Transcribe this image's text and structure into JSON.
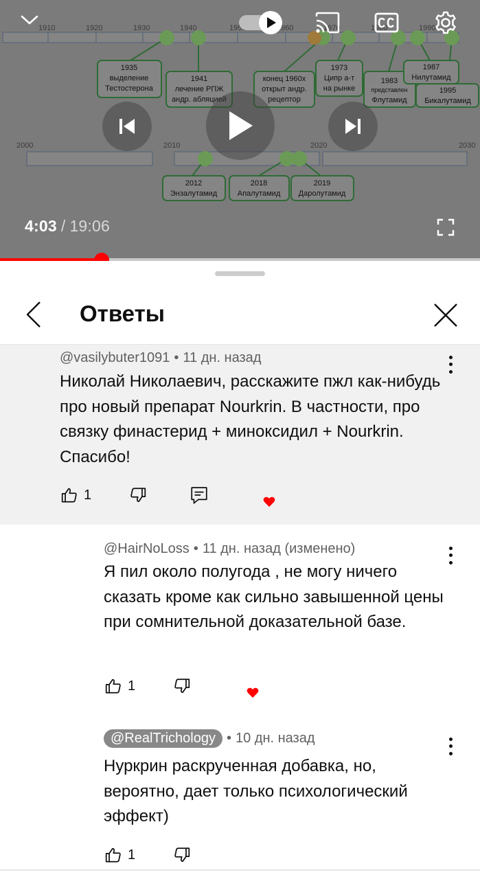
{
  "player": {
    "current_time": "4:03",
    "separator": "/",
    "duration": "19:06",
    "progress": 0.212,
    "icons": {
      "collapse": "chevron-down-icon",
      "autoplay": "autoplay-toggle-icon",
      "cast": "cast-icon",
      "captions": "captions-icon",
      "settings": "gear-icon",
      "previous": "skip-previous-icon",
      "play": "play-icon",
      "next": "skip-next-icon",
      "fullscreen": "fullscreen-icon"
    },
    "slide": {
      "timeline1_ticks": [
        "1910",
        "1920",
        "1930",
        "1940",
        "1950",
        "1960",
        "1970",
        "1980",
        "1990"
      ],
      "timeline2_ticks": [
        "2000",
        "2010",
        "2020",
        "2030"
      ],
      "events": [
        {
          "year": "1935",
          "text1": "выделение",
          "text2": "Тестостерона"
        },
        {
          "year": "1941",
          "text1": "лечение РПЖ",
          "text2": "андр. абляцией"
        },
        {
          "year": "конец 1960х",
          "text1": "открыт андр.",
          "text2": "рецептор"
        },
        {
          "year": "1973",
          "text1": "Ципр а-т",
          "text2": "на рынке"
        },
        {
          "year": "1983",
          "text1": "представлен",
          "text2": "Флутамид"
        },
        {
          "year": "1987",
          "text1": "Нилутамид",
          "text2": ""
        },
        {
          "year": "1995",
          "text1": "Бикалутамид",
          "text2": ""
        },
        {
          "year": "2012",
          "text1": "Энзалутамид",
          "text2": ""
        },
        {
          "year": "2018",
          "text1": "Апалутамид",
          "text2": ""
        },
        {
          "year": "2019",
          "text1": "Даролутамид",
          "text2": ""
        }
      ]
    }
  },
  "sheet": {
    "title": "Ответы",
    "back_icon": "chevron-left-icon",
    "close_icon": "close-icon"
  },
  "comments": [
    {
      "author": "@vasilybuter1091",
      "time": "11 дн. назад",
      "edited": "",
      "body": "Николай Николаевич, расскажите пжл как-нибудь про новый препарат Nourkrin. В частности, про связку финастерид + миноксидил +  Nourkrin. Спасибо!",
      "likes": "1",
      "creator_heart": true,
      "has_reply_button": true
    },
    {
      "author": "@HairNoLoss",
      "time": "11 дн. назад",
      "edited": "(изменено)",
      "body": "Я пил около полугода , не могу ничего сказать кроме как сильно завышенной цены при сомнительной доказательной базе.",
      "likes": "1",
      "creator_heart": true,
      "has_reply_button": false
    },
    {
      "author": "@RealTrichology",
      "time": "10 дн. назад",
      "edited": "",
      "body": "Нуркрин раскрученная добавка, но, вероятно, дает только психологический эффект)",
      "likes": "1",
      "creator_heart": false,
      "has_reply_button": false
    }
  ],
  "colors": {
    "accent": "#ff0000",
    "overlay": "#7b7b7b",
    "comment_highlight": "#f1f1f1",
    "meta_text": "#606060",
    "slide_green": "#2e7d32",
    "slide_dot": "#6aa84f"
  }
}
